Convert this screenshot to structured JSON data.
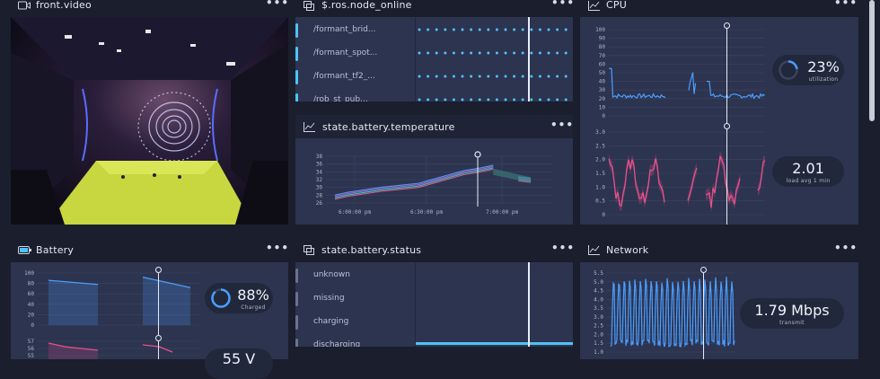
{
  "video": {
    "title": "front.video",
    "icon": "video-icon",
    "menu": "•••"
  },
  "node_online": {
    "title": "$.ros.node_online",
    "icon": "layers-icon",
    "menu": "•••",
    "rows": [
      "/formant_brid...",
      "/formant_spot...",
      "/formant_tf2_...",
      "/rob_st_pub..."
    ],
    "accent": "#4fc3f7"
  },
  "battery_temp": {
    "title": "state.battery.temperature",
    "icon": "line-chart-icon",
    "menu": "•••",
    "chart_data": {
      "type": "line",
      "y_ticks": [
        "38",
        "36",
        "34",
        "32",
        "30",
        "28",
        "26"
      ],
      "x_ticks": [
        "6:00:00 pm",
        "6:30:00 pm",
        "7:00:00 pm"
      ],
      "ylim": [
        26,
        38
      ],
      "series": [
        {
          "x": [
            0.0,
            0.06,
            0.22,
            0.4,
            0.62,
            0.7,
            0.76,
            0.82,
            0.88,
            0.94
          ],
          "y": [
            27.5,
            28.2,
            29.5,
            30.5,
            33.8,
            34.5,
            35.2,
            null,
            32.2,
            31.8
          ]
        }
      ],
      "colors": [
        "#e06090",
        "#40d0c0",
        "#a070e0",
        "#60a0ff"
      ]
    }
  },
  "cpu": {
    "title": "CPU",
    "icon": "line-chart-icon",
    "menu": "•••",
    "util_value": "23%",
    "util_label": "utilization",
    "util_fraction": 0.23,
    "load_value": "2.01",
    "load_label": "load avg 1 min",
    "top_chart": {
      "type": "line",
      "y_ticks": [
        "100",
        "90",
        "80",
        "70",
        "60",
        "50",
        "40",
        "30",
        "20",
        "10",
        "0"
      ],
      "ylim": [
        0,
        100
      ],
      "color": "#4a9eff"
    },
    "bottom_chart": {
      "type": "line",
      "y_ticks": [
        "3.0",
        "2.5",
        "2.0",
        "1.5",
        "1.0",
        "0.5",
        "0"
      ],
      "ylim": [
        0,
        3
      ],
      "color": "#e8508a"
    }
  },
  "battery": {
    "title": "Battery",
    "icon": "battery-icon",
    "menu": "•••",
    "charge_value": "88%",
    "charge_label": "Charged",
    "charge_fraction": 0.88,
    "volt_value": "55 V",
    "top_chart": {
      "type": "area",
      "y_ticks": [
        "100",
        "80",
        "60",
        "40",
        "20",
        "0"
      ],
      "ylim": [
        0,
        100
      ],
      "color": "#4a9eff"
    },
    "bottom_chart": {
      "type": "area",
      "y_ticks": [
        "57",
        "56",
        "55"
      ],
      "color": "#e8508a"
    }
  },
  "battery_status": {
    "title": "state.battery.status",
    "icon": "layers-icon",
    "menu": "•••",
    "rows": [
      "unknown",
      "missing",
      "charging",
      "discharging"
    ],
    "accent": "#4fc3f7"
  },
  "network": {
    "title": "Network",
    "icon": "line-chart-icon",
    "menu": "•••",
    "value": "1.79 Mbps",
    "label": "transmit",
    "chart_data": {
      "type": "line",
      "y_ticks": [
        "5.5",
        "5.0",
        "4.5",
        "4.0",
        "3.5",
        "3.0",
        "2.5",
        "2.0",
        "1.5",
        "1.0"
      ],
      "ylim": [
        1.0,
        5.5
      ],
      "color": "#4a9eff"
    }
  }
}
